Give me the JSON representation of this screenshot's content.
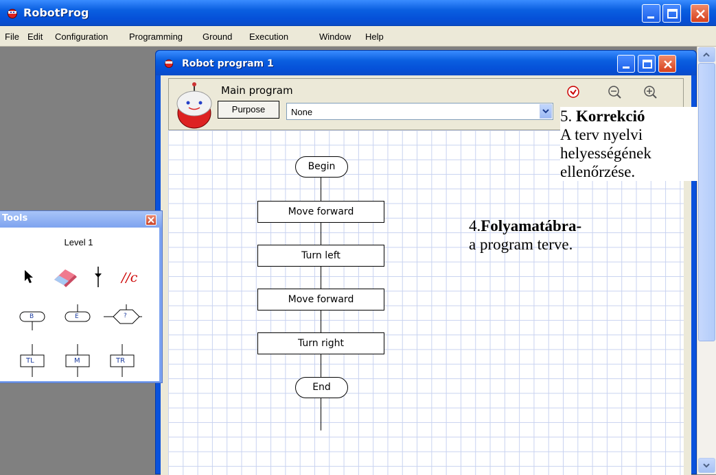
{
  "app": {
    "title": "RobotProg"
  },
  "menu": [
    "File",
    "Edit",
    "Configuration",
    "Programming",
    "Ground",
    "Execution",
    "Window",
    "Help"
  ],
  "program_window": {
    "title": "Robot program 1",
    "main_label": "Main program",
    "purpose_button": "Purpose",
    "purpose_value": "None",
    "icons": [
      "check-circle-icon",
      "zoom-out-icon",
      "zoom-in-icon"
    ]
  },
  "flowchart": {
    "begin": "Begin",
    "steps": [
      "Move forward",
      "Turn left",
      "Move forward",
      "Turn right"
    ],
    "end": "End"
  },
  "tools": {
    "title": "Tools",
    "level": "Level 1",
    "row1": [
      "arrow-pointer-icon",
      "eraser-icon",
      "connector-icon",
      "comment-icon"
    ],
    "comment_glyph": "//c",
    "row2": [
      "B",
      "E",
      "?"
    ],
    "row3": [
      "TL",
      "M",
      "TR"
    ]
  },
  "annotations": {
    "korr_num": "5.",
    "korr_title": "Korrekció",
    "korr_line1": "A terv nyelvi",
    "korr_line2": "helyességének",
    "korr_line3": "ellenőrzése.",
    "folyam_num": "4.",
    "folyam_title": "Folyamatábra-",
    "folyam_line": "a program terve."
  },
  "colors": {
    "titlebar": "#0a5fe0",
    "close_button": "#d6401c",
    "grid": "#c8d2f0",
    "mdi_background": "#808080"
  }
}
